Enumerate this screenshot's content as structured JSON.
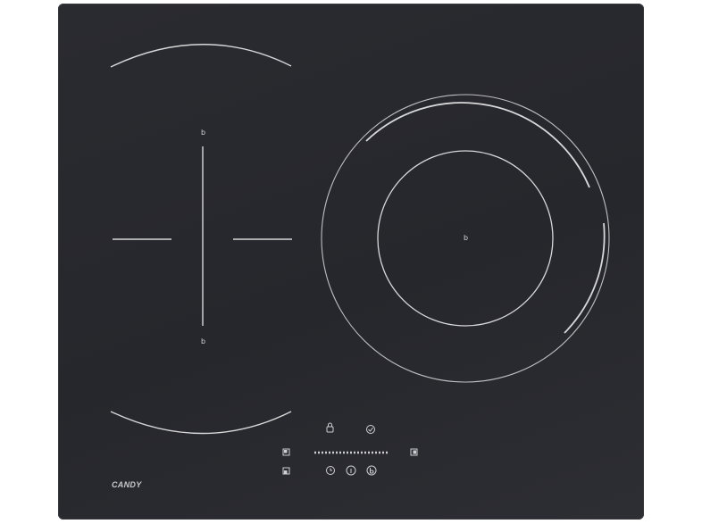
{
  "brand": "CANDY",
  "zone_marker": "b",
  "colors": {
    "glass": "#28292e",
    "marking": "#d8d8da"
  },
  "controls": {
    "top_row": [
      "lock-icon",
      "check-icon"
    ],
    "left_selectors": [
      "zone-select-top-icon",
      "zone-select-bottom-icon"
    ],
    "right_selector": "zone-select-right-icon",
    "bottom_row": [
      "timer-icon",
      "info-icon",
      "power-icon"
    ],
    "slider_steps": 20
  }
}
